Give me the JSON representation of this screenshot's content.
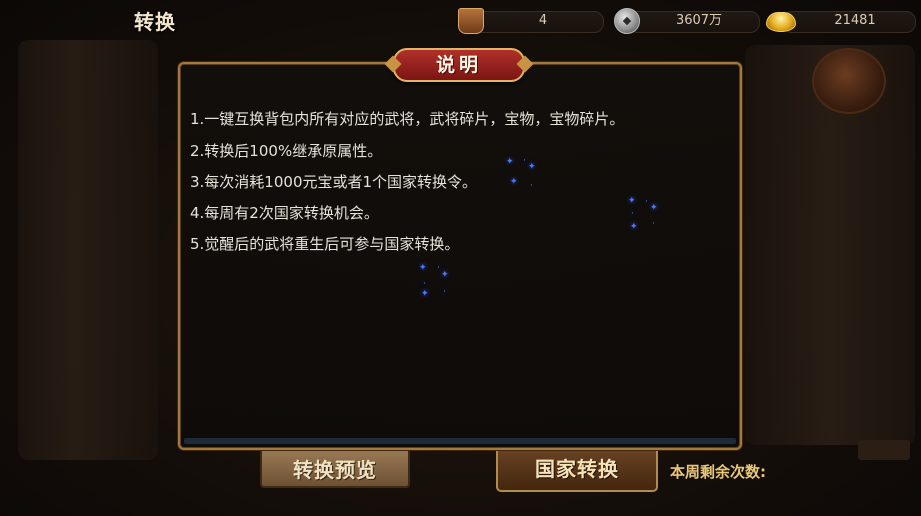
{
  "header": {
    "title": "转换"
  },
  "resources": [
    {
      "icon": "token-icon",
      "value": "4"
    },
    {
      "icon": "silver-coin-icon",
      "value": "3607万"
    },
    {
      "icon": "gold-ingot-icon",
      "value": "21481"
    }
  ],
  "dialog": {
    "title": "说明",
    "rules": [
      "1.一键互换背包内所有对应的武将，武将碎片，宝物，宝物碎片。",
      "2.转换后100%继承原属性。",
      "3.每次消耗1000元宝或者1个国家转换令。",
      "4.每周有2次国家转换机会。",
      "5.觉醒后的武将重生后可参与国家转换。"
    ]
  },
  "buttons": {
    "preview_label": "转换预览",
    "convert_label": "国家转换"
  },
  "remaining_label": "本周剩余次数:",
  "colors": {
    "dialog_border": "#a5793e",
    "title_plate": "#b1302a",
    "sparkle": "#4d7bff"
  }
}
